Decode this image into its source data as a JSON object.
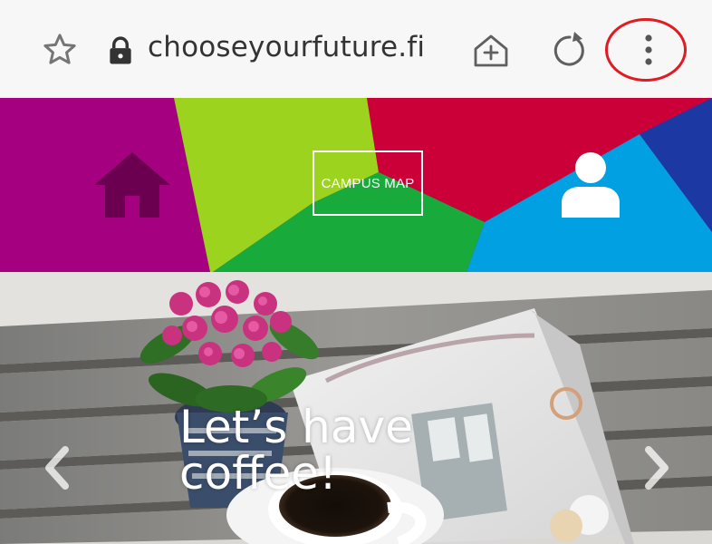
{
  "browser": {
    "url": "chooseyourfuture.fi",
    "icons": {
      "bookmark": "star-outline-icon",
      "secure": "lock-icon",
      "add_home": "add-to-home-icon",
      "reload": "reload-icon",
      "menu": "more-vert-icon"
    },
    "highlight_color": "#e01b22"
  },
  "header": {
    "home_icon": "home-icon",
    "campus_map_label": "CAMPUS MAP",
    "profile_icon": "user-icon",
    "colors": {
      "magenta": "#a5007f",
      "lime": "#9bd31e",
      "crimson": "#cb0038",
      "green": "#18ab3b",
      "sky_blue": "#00a0e2",
      "navy": "#1c38a2",
      "home_icon": "#6b0050"
    }
  },
  "hero": {
    "title_line1": "Let’s have",
    "title_line2": "coffee!",
    "prev_icon": "chevron-left-icon",
    "next_icon": "chevron-right-icon"
  }
}
